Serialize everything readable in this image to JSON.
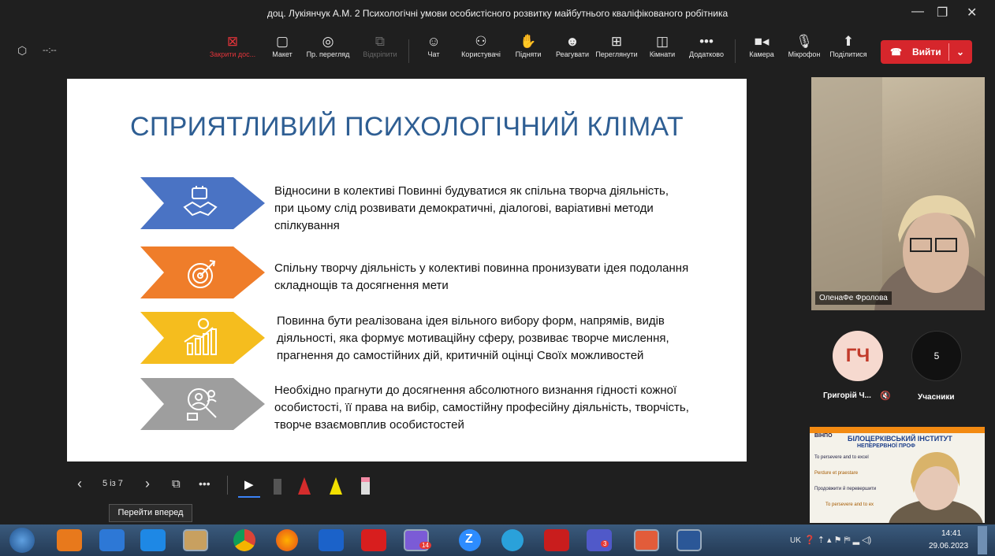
{
  "window": {
    "title": "доц. Лукіянчук А.М. 2 Психологічні умови особистісного розвитку майбутнього кваліфікованого робітника"
  },
  "toolbar": {
    "timer": "--:--",
    "items": [
      {
        "label": "Закрити дос...",
        "icon": "close-share-icon"
      },
      {
        "label": "Макет",
        "icon": "layout-icon"
      },
      {
        "label": "Пр. перегляд",
        "icon": "eye-icon"
      },
      {
        "label": "Відкріпити",
        "icon": "unpin-icon"
      },
      {
        "label": "Чат",
        "icon": "chat-icon"
      },
      {
        "label": "Користувачі",
        "icon": "people-icon"
      },
      {
        "label": "Підняти",
        "icon": "hand-icon"
      },
      {
        "label": "Реагувати",
        "icon": "smile-icon"
      },
      {
        "label": "Переглянути",
        "icon": "grid-icon"
      },
      {
        "label": "Кімнати",
        "icon": "rooms-icon"
      },
      {
        "label": "Додатково",
        "icon": "more-icon"
      },
      {
        "label": "Камера",
        "icon": "camera-icon"
      },
      {
        "label": "Мікрофон",
        "icon": "mic-icon"
      },
      {
        "label": "Поділитися",
        "icon": "share-icon"
      }
    ],
    "leave_label": "Вийти"
  },
  "slide": {
    "title": "СПРИЯТЛИВИЙ ПСИХОЛОГІЧНИЙ КЛІМАТ",
    "rows": [
      {
        "text": "Відносини в колективі Повинні будуватися як спільна творча діяльність, при цьому слід розвивати демократичні, діалогові, варіативні методи спілкування",
        "color": "#4a73c4"
      },
      {
        "text": "Спільну творчу діяльність у колективі повинна пронизувати ідея подолання складнощів та досягнення мети",
        "color": "#ef7d2a"
      },
      {
        "text": "Повинна бути реалізована ідея вільного вибору форм, напрямів, видів діяльності, яка формує мотиваційну сферу, розвиває творче мислення, прагнення до самостійних дій, критичній оцінці Своїх можливостей",
        "color": "#f5bd1e"
      },
      {
        "text": "Необхідно прагнути до досягнення абсолютного визнання гідності кожної особистості, її права на вибір, самостійну професійну діяльність, творчість, творче взаємовплив особистостей",
        "color": "#9e9e9e"
      }
    ]
  },
  "participants": {
    "video_name": "ОленаФе Фролова",
    "avatar_initials": "ГЧ",
    "avatar_name": "Григорій Ч...",
    "count": "5",
    "count_label": "Учасники"
  },
  "thumbnail": {
    "line1": "БІЛОЦЕРКІВСЬКИЙ ІНСТИТУТ",
    "line2": "НЕПЕРЕРВНОЇ ПРОФ",
    "tag": "ВІНПО",
    "t1": "To persevere and to excel",
    "t2": "Perdure et praestare",
    "t3": "Продовжити й перевершити",
    "t4": "To persevere and to ex"
  },
  "presenter_bar": {
    "page": "5 із 7",
    "tooltip": "Перейти вперед"
  },
  "taskbar": {
    "lang": "UK",
    "time": "14:41",
    "date": "29.06.2023",
    "viber_badge": "14",
    "teams_badge": "3"
  },
  "colors": {
    "accent_red": "#d6262c",
    "title_blue": "#2e5e93"
  }
}
